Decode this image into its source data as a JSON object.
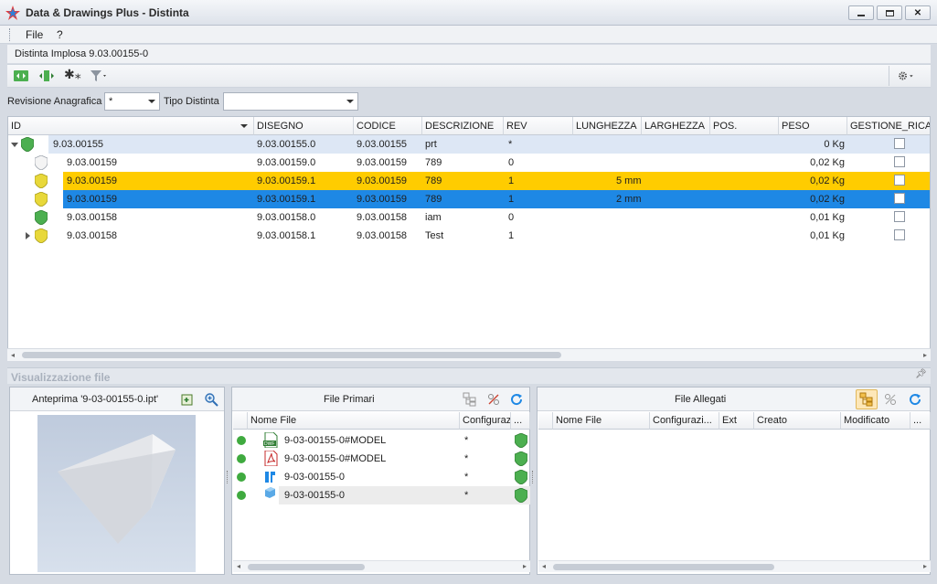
{
  "window": {
    "title": "Data & Drawings Plus - Distinta",
    "minimize": "–",
    "maximize": "□",
    "close": "✕"
  },
  "menu": {
    "file": "File",
    "help": "?"
  },
  "document": {
    "title": "Distinta Implosa 9.03.00155-0"
  },
  "toolbar": {
    "icons": [
      "expand-icon",
      "collapse-icon",
      "asterisk-icon",
      "filter-icon",
      "settings-icon"
    ]
  },
  "filters": {
    "revisione_label": "Revisione Anagrafica",
    "revisione_value": "*",
    "tipo_label": "Tipo Distinta",
    "tipo_value": ""
  },
  "grid": {
    "columns": [
      "ID",
      "DISEGNO",
      "CODICE",
      "DESCRIZIONE",
      "REV",
      "LUNGHEZZA",
      "LARGHEZZA",
      "POS.",
      "PESO",
      "GESTIONE_RICAM"
    ],
    "rows": [
      {
        "id": "9.03.00155",
        "disegno": "9.03.00155.0",
        "codice": "9.03.00155",
        "descrizione": "prt",
        "rev": "*",
        "lunghezza": "",
        "larghezza": "",
        "pos": "",
        "peso": "0 Kg",
        "shield": "green",
        "state": "root"
      },
      {
        "id": "9.03.00159",
        "disegno": "9.03.00159.0",
        "codice": "9.03.00159",
        "descrizione": "789",
        "rev": "0",
        "lunghezza": "",
        "larghezza": "",
        "pos": "",
        "peso": "0,02 Kg",
        "shield": "white",
        "state": "normal"
      },
      {
        "id": "9.03.00159",
        "disegno": "9.03.00159.1",
        "codice": "9.03.00159",
        "descrizione": "789",
        "rev": "1",
        "lunghezza": "5 mm",
        "larghezza": "",
        "pos": "",
        "peso": "0,02 Kg",
        "shield": "yellow",
        "state": "highlight"
      },
      {
        "id": "9.03.00159",
        "disegno": "9.03.00159.1",
        "codice": "9.03.00159",
        "descrizione": "789",
        "rev": "1",
        "lunghezza": "2 mm",
        "larghezza": "",
        "pos": "",
        "peso": "0,02 Kg",
        "shield": "yellow",
        "state": "selected"
      },
      {
        "id": "9.03.00158",
        "disegno": "9.03.00158.0",
        "codice": "9.03.00158",
        "descrizione": "iam",
        "rev": "0",
        "lunghezza": "",
        "larghezza": "",
        "pos": "",
        "peso": "0,01 Kg",
        "shield": "green",
        "state": "normal"
      },
      {
        "id": "9.03.00158",
        "disegno": "9.03.00158.1",
        "codice": "9.03.00158",
        "descrizione": "Test",
        "rev": "1",
        "lunghezza": "",
        "larghezza": "",
        "pos": "",
        "peso": "0,01 Kg",
        "shield": "yellow",
        "state": "collapsed"
      }
    ]
  },
  "visualization": {
    "title": "Visualizzazione file",
    "preview_title": "Anteprima '9-03-00155-0.ipt'",
    "primary": {
      "title": "File Primari",
      "columns": [
        "Nome File",
        "Configurazi...",
        "..."
      ],
      "files": [
        {
          "name": "9-03-00155-0#MODEL",
          "config": "*",
          "type": "dwf-icon"
        },
        {
          "name": "9-03-00155-0#MODEL",
          "config": "*",
          "type": "pdf-icon"
        },
        {
          "name": "9-03-00155-0",
          "config": "*",
          "type": "drawing-icon"
        },
        {
          "name": "9-03-00155-0",
          "config": "*",
          "type": "part-icon"
        }
      ]
    },
    "attachments": {
      "title": "File Allegati",
      "columns": [
        "Nome File",
        "Configurazi...",
        "Ext",
        "Creato",
        "Modificato",
        "..."
      ]
    }
  },
  "colors": {
    "highlight": "#ffcc00",
    "selected": "#1e88e5",
    "root_row": "#dde7f5"
  }
}
